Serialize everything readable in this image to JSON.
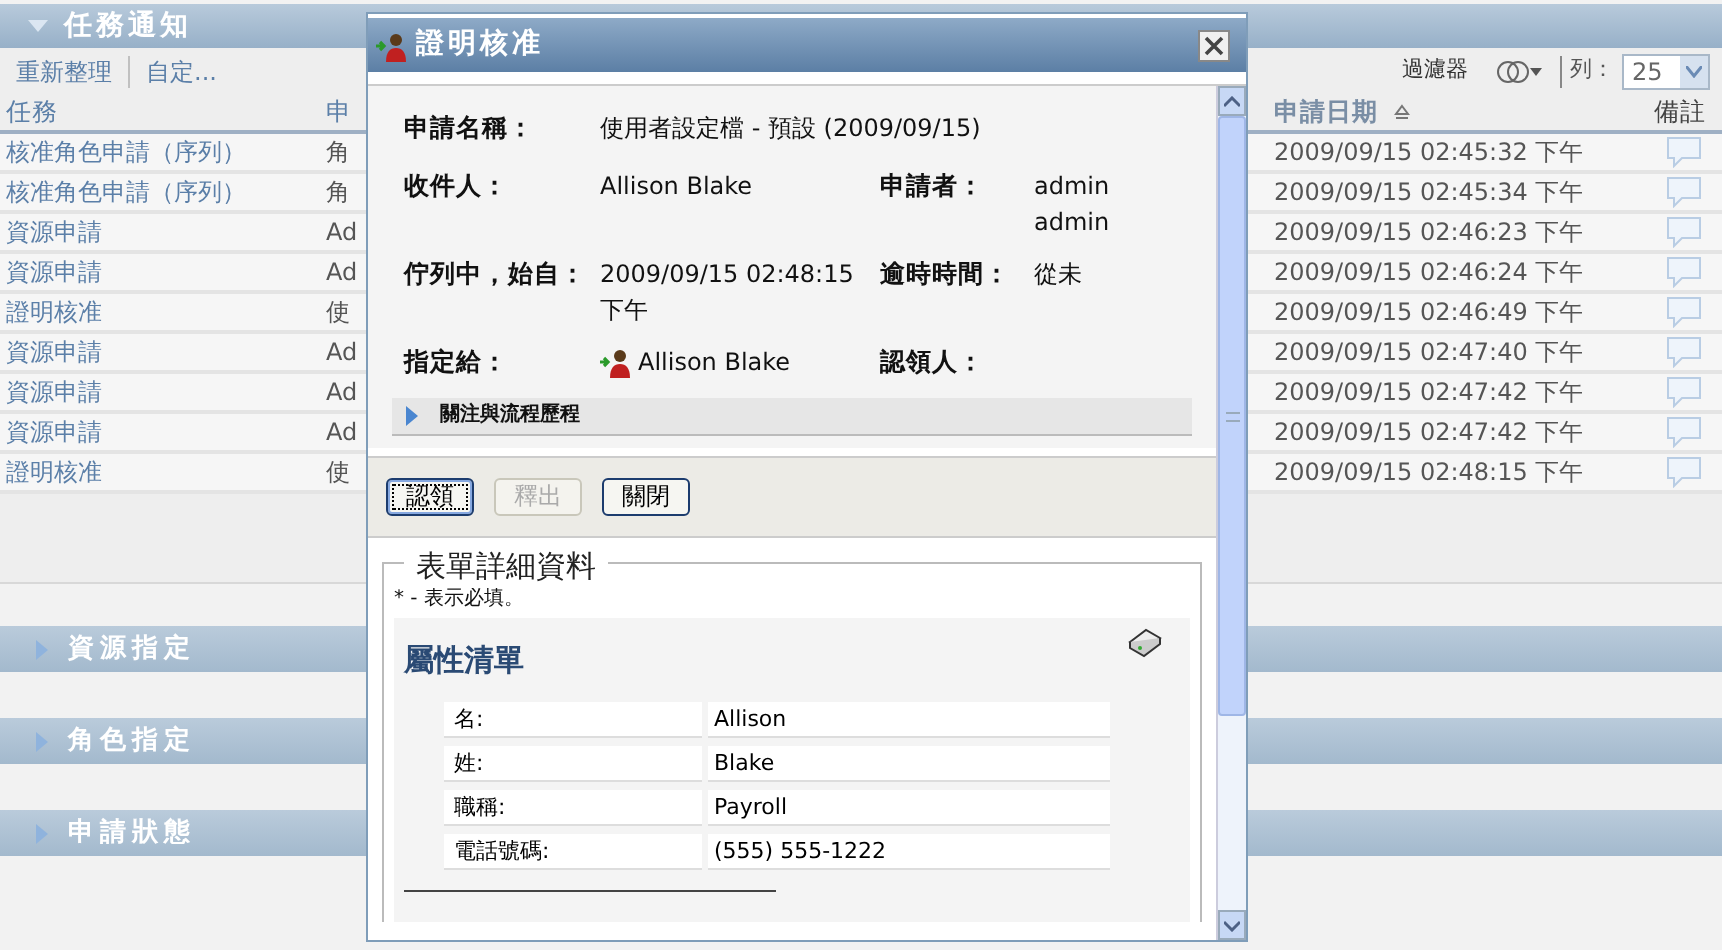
{
  "panel": {
    "title": "任務通知",
    "expanded": true
  },
  "toolbar": {
    "actions": [
      "重新整理",
      "自定..."
    ],
    "filter": "過濾器",
    "rows_label": "列：",
    "rows_value": "25"
  },
  "table": {
    "columns": [
      {
        "label": "任務",
        "sorted": false
      },
      {
        "label": "申",
        "sorted": false
      },
      {
        "label": "申請日期",
        "sorted": true
      },
      {
        "label": "備註",
        "sorted": false
      }
    ],
    "rows": [
      {
        "task": "核准角色申請（序列）",
        "column_2": "角",
        "date": "2009/09/15 02:45:32 下午"
      },
      {
        "task": "核准角色申請（序列）",
        "column_2": "角",
        "date": "2009/09/15 02:45:34 下午"
      },
      {
        "task": "資源申請",
        "column_2": "Ad",
        "date": "2009/09/15 02:46:23 下午"
      },
      {
        "task": "資源申請",
        "column_2": "Ad",
        "date": "2009/09/15 02:46:24 下午"
      },
      {
        "task": "證明核准",
        "column_2": "使",
        "date": "2009/09/15 02:46:49 下午"
      },
      {
        "task": "資源申請",
        "column_2": "Ad",
        "date": "2009/09/15 02:47:40 下午"
      },
      {
        "task": "資源申請",
        "column_2": "Ad",
        "date": "2009/09/15 02:47:42 下午"
      },
      {
        "task": "資源申請",
        "column_2": "Ad",
        "date": "2009/09/15 02:47:42 下午"
      },
      {
        "task": "證明核准",
        "column_2": "使",
        "date": "2009/09/15 02:48:15 下午"
      }
    ]
  },
  "sections": [
    {
      "title": "資源指定",
      "expanded": false
    },
    {
      "title": "角色指定",
      "expanded": false
    },
    {
      "title": "申請狀態",
      "expanded": false
    }
  ],
  "dialog": {
    "title": "證明核准",
    "request_name": {
      "label": "申請名稱：",
      "value": "使用者設定檔 - 預設 (2009/09/15)"
    },
    "fields": [
      {
        "label": "收件人：",
        "value": "Allison Blake",
        "label_2": "申請者：",
        "value_2": "admin admin"
      },
      {
        "label": "佇列中，始自：",
        "value": "2009/09/15 02:48:15 下午",
        "label_2": "逾時時間：",
        "value_2": "從未"
      },
      {
        "label": "指定給：",
        "value": "Allison Blake",
        "label_2": "認領人："
      }
    ],
    "comments_toggle": {
      "label": "關注與流程歷程",
      "expanded": false
    },
    "buttons": [
      {
        "label": "認領",
        "disabled": false,
        "focused": true
      },
      {
        "label": "釋出",
        "disabled": true,
        "focused": false
      },
      {
        "label": "關閉",
        "disabled": false,
        "focused": false
      }
    ],
    "form": {
      "legend": "表單詳細資料",
      "required_note": "* - 表示必填。",
      "heading": "屬性清單",
      "rows": [
        {
          "label": "名:",
          "value": "Allison"
        },
        {
          "label": "姓:",
          "value": "Blake"
        },
        {
          "label": "職稱:",
          "value": "Payroll"
        },
        {
          "label": "電話號碼:",
          "value": "(555) 555-1222"
        }
      ]
    }
  }
}
